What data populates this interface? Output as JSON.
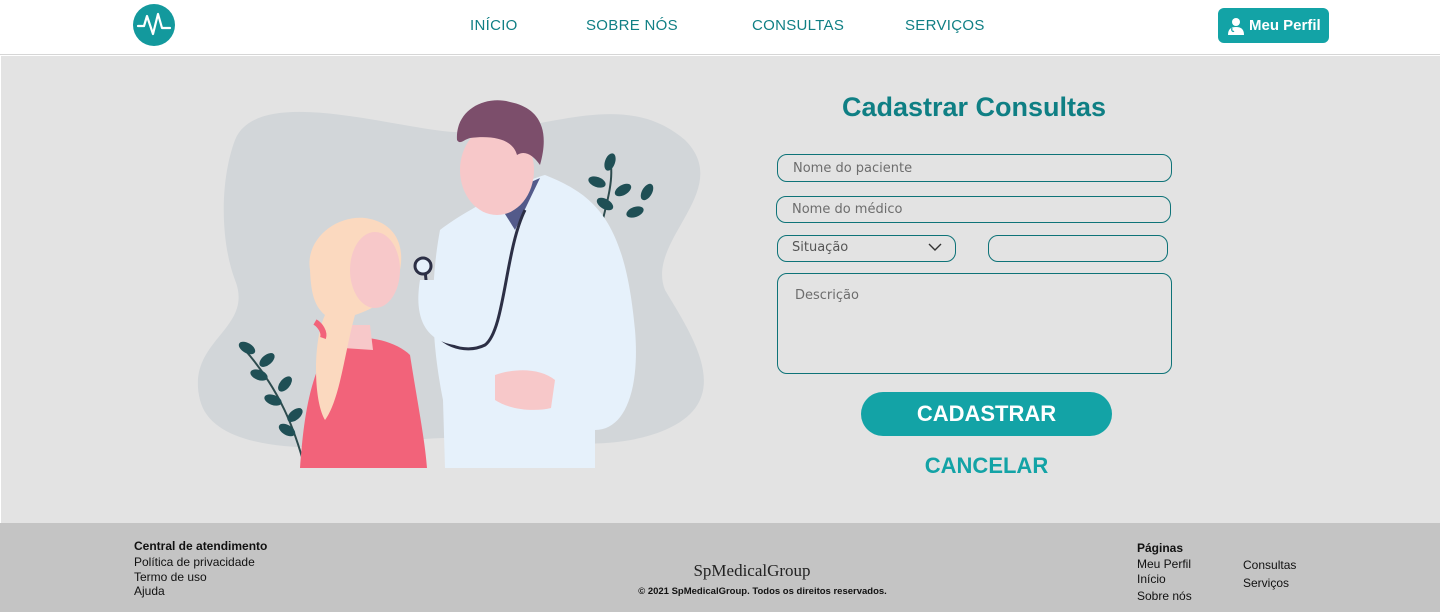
{
  "header": {
    "logo_icon": "heartbeat-icon",
    "nav": [
      {
        "label": "INÍCIO"
      },
      {
        "label": "SOBRE NÓS"
      },
      {
        "label": "CONSULTAS"
      },
      {
        "label": "SERVIÇOS"
      }
    ],
    "profile_button": {
      "label": "Meu Perfil",
      "icon": "doctor-icon"
    }
  },
  "form": {
    "title": "Cadastrar Consultas",
    "patient_placeholder": "Nome do paciente",
    "doctor_placeholder": "Nome do médico",
    "status_select": {
      "value": "Situação",
      "icon": "chevron-down-icon"
    },
    "date_value": "",
    "description_placeholder": "Descrição",
    "submit_label": "CADASTRAR",
    "cancel_label": "CANCELAR"
  },
  "footer": {
    "support": {
      "title": "Central de atendimento",
      "links": [
        "Política de privacidade",
        "Termo de uso",
        "Ajuda"
      ]
    },
    "brand": "SpMedicalGroup",
    "copyright": "© 2021 SpMedicalGroup. Todos os direitos reservados.",
    "pages": {
      "title": "Páginas",
      "col1": [
        "Meu Perfil",
        "Início",
        "Sobre nós"
      ],
      "col2": [
        "Consultas",
        "Serviços"
      ]
    }
  },
  "colors": {
    "primary": "#13a3a6",
    "primary_dark": "#0f7f84",
    "main_bg": "#e3e3e3",
    "footer_bg": "#c4c4c4"
  }
}
